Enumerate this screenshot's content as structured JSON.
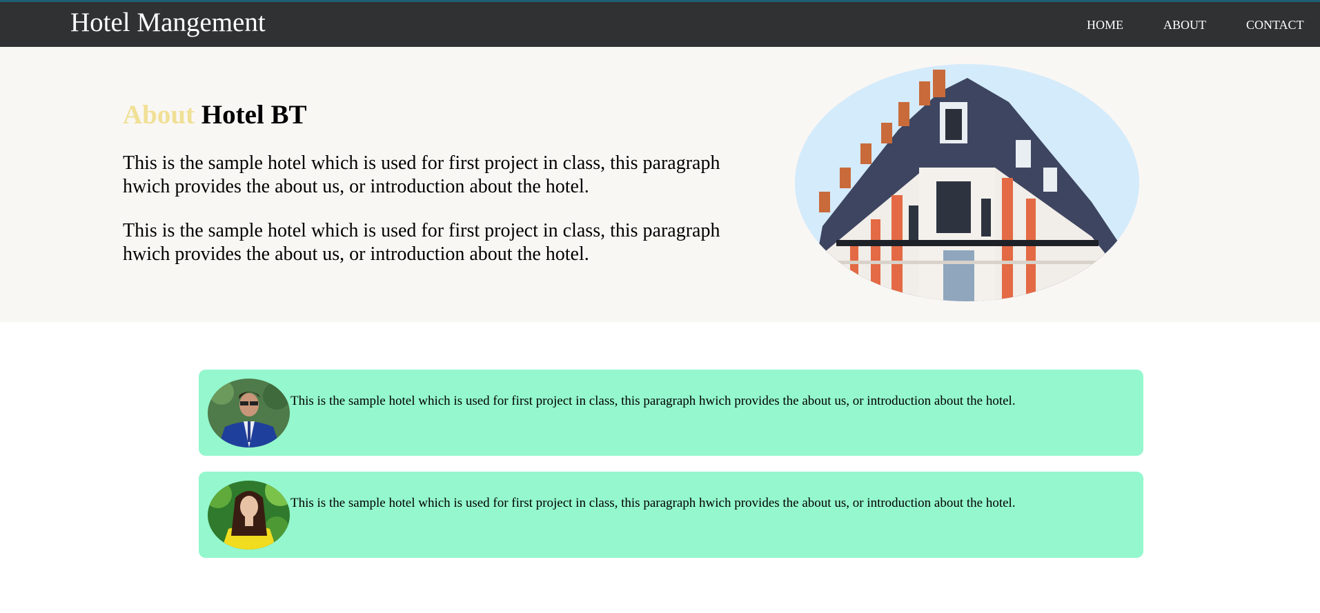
{
  "navbar": {
    "brand": "Hotel Mangement",
    "links": [
      {
        "label": "HOME"
      },
      {
        "label": "ABOUT"
      },
      {
        "label": "CONTACT"
      }
    ]
  },
  "about": {
    "heading_accent": "About",
    "heading_name": "Hotel BT",
    "paragraphs": [
      "This is the sample hotel which is used for first project in class, this paragraph hwich provides the about us, or introduction about the hotel.",
      "This is the sample hotel which is used for first project in class, this paragraph hwich provides the about us, or introduction about the hotel."
    ]
  },
  "cards": [
    {
      "text": "This is the sample hotel which is used for first project in class, this paragraph hwich provides the about us, or introduction about the hotel."
    },
    {
      "text": "This is the sample hotel which is used for first project in class, this paragraph hwich provides the about us, or introduction about the hotel."
    }
  ],
  "colors": {
    "navbar_bg": "#2f3133",
    "about_bg": "#f9f7f4",
    "heading_accent": "#f0e096",
    "card_bg": "#94f7cd"
  }
}
